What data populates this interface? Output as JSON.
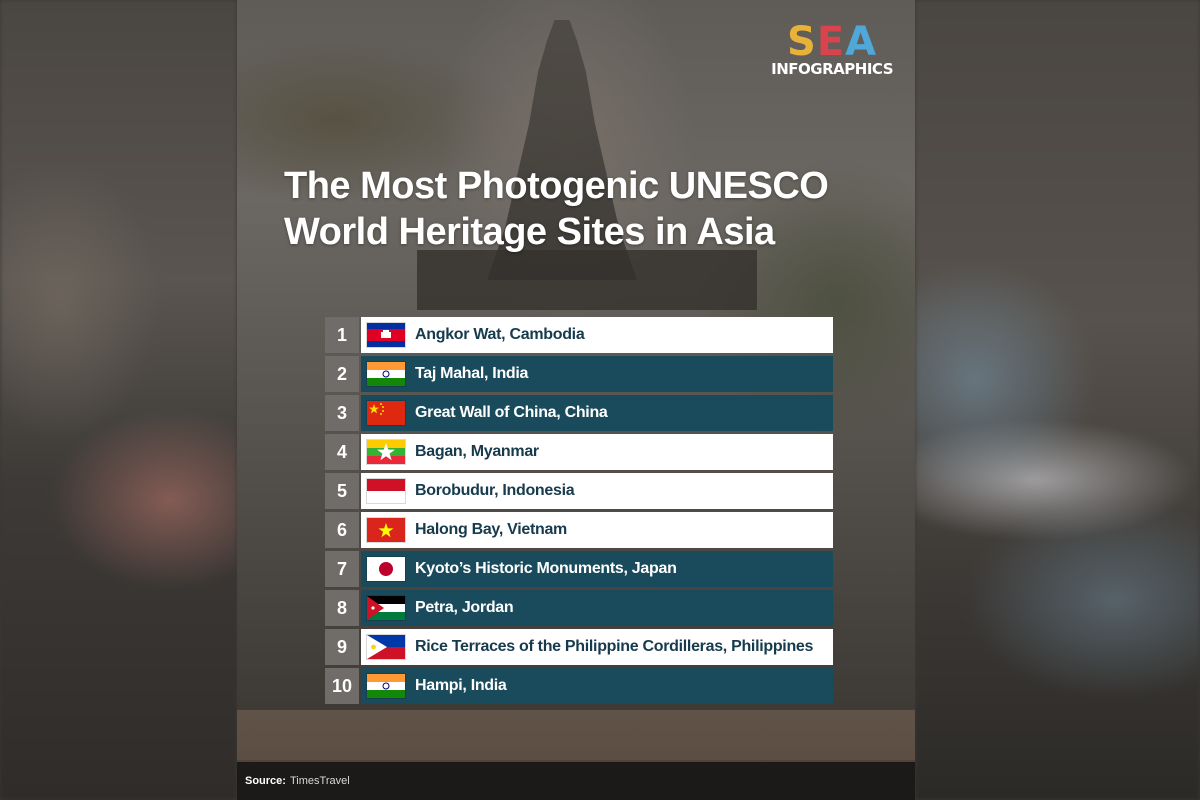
{
  "logo": {
    "brand": "SEA",
    "sub": "INFOGRAPHICS"
  },
  "title": "The Most Photogenic UNESCO World Heritage Sites in Asia",
  "ranking": [
    {
      "rank": "1",
      "site": "Angkor Wat, Cambodia",
      "flag": "cambodia-flag-icon",
      "style": "light"
    },
    {
      "rank": "2",
      "site": "Taj Mahal, India",
      "flag": "india-flag-icon",
      "style": "dark"
    },
    {
      "rank": "3",
      "site": "Great Wall of China, China",
      "flag": "china-flag-icon",
      "style": "dark"
    },
    {
      "rank": "4",
      "site": "Bagan, Myanmar",
      "flag": "myanmar-flag-icon",
      "style": "light"
    },
    {
      "rank": "5",
      "site": "Borobudur, Indonesia",
      "flag": "indonesia-flag-icon",
      "style": "light"
    },
    {
      "rank": "6",
      "site": "Halong Bay, Vietnam",
      "flag": "vietnam-flag-icon",
      "style": "light"
    },
    {
      "rank": "7",
      "site": "Kyoto’s Historic Monuments, Japan",
      "flag": "japan-flag-icon",
      "style": "dark"
    },
    {
      "rank": "8",
      "site": "Petra, Jordan",
      "flag": "jordan-flag-icon",
      "style": "dark"
    },
    {
      "rank": "9",
      "site": "Rice Terraces of the Philippine Cordilleras, Philippines",
      "flag": "philippines-flag-icon",
      "style": "light"
    },
    {
      "rank": "10",
      "site": "Hampi, India",
      "flag": "india-flag-icon",
      "style": "dark"
    }
  ],
  "footer": {
    "label": "Source:",
    "value": "TimesTravel"
  },
  "colors": {
    "dark_row": "#1a4b5d",
    "light_row": "#ffffff",
    "rank_box": "#6f6c69"
  }
}
